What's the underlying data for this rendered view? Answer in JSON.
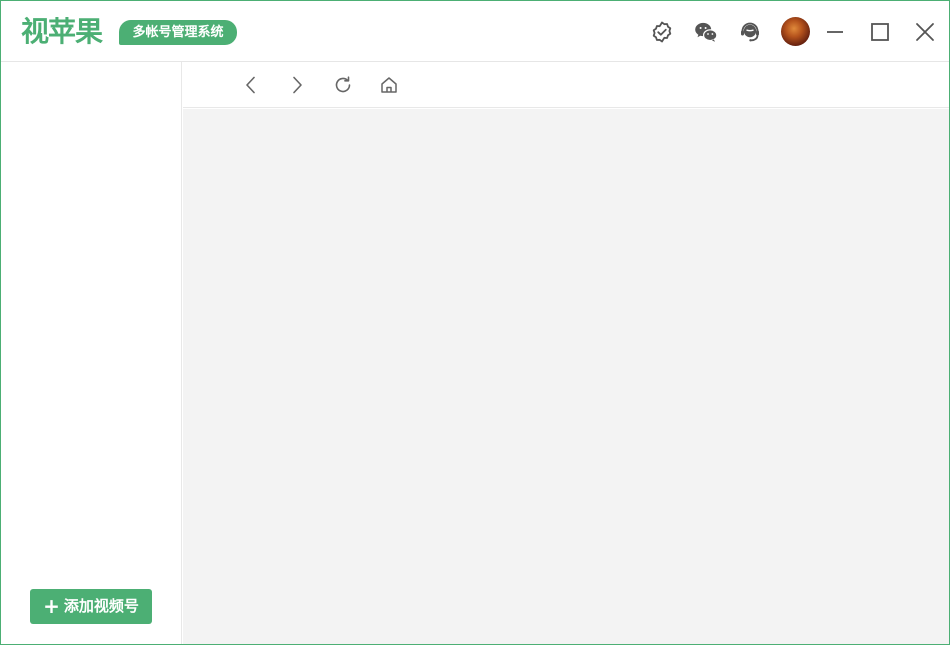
{
  "app": {
    "logo_text": "视苹果",
    "tagline": "多帐号管理系统"
  },
  "titlebar": {
    "icons": [
      "verified-badge-icon",
      "wechat-icon",
      "customer-service-icon",
      "user-avatar",
      "minimize-icon",
      "maximize-icon",
      "close-icon"
    ]
  },
  "sidebar": {
    "add_button_plus": "+",
    "add_button_label": "添加视频号"
  },
  "navbar": {
    "icons": [
      "back-arrow-icon",
      "forward-arrow-icon",
      "refresh-icon",
      "home-icon"
    ]
  },
  "colors": {
    "brand_green": "#4caf74",
    "content_bg": "#f3f3f3",
    "icon_gray": "#555555"
  }
}
